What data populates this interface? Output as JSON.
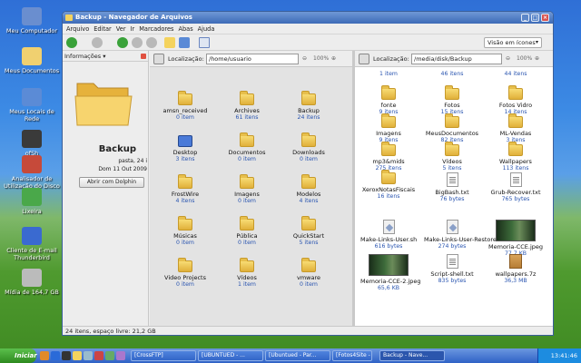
{
  "desktop": {
    "icons": [
      {
        "name": "computer-icon",
        "label": "Meu Computador"
      },
      {
        "name": "documents-icon",
        "label": "Meus Documentos"
      },
      {
        "name": "network-icon",
        "label": "Meus Locais de Rede"
      },
      {
        "name": "ssh-icon",
        "label": "ofSh"
      },
      {
        "name": "disk-analyzer-icon",
        "label": "Analisador de Utilização do Disco"
      },
      {
        "name": "trash-icon",
        "label": "Lixeira"
      },
      {
        "name": "thunderbird-icon",
        "label": "Cliente de E-mail Thunderbird"
      },
      {
        "name": "drive-icon",
        "label": "Mídia de 164,7 GB"
      }
    ]
  },
  "window": {
    "title": "Backup - Navegador de Arquivos",
    "menu": [
      "Arquivo",
      "Editar",
      "Ver",
      "Ir",
      "Marcadores",
      "Abas",
      "Ajuda"
    ],
    "view_mode": "Visão em ícones",
    "sidebar": {
      "header": "Informações",
      "name": "Backup",
      "type": "pasta, 24 i",
      "date": "Dom 11 Out 2009",
      "button": "Abrir com Dolphin"
    },
    "pane1": {
      "location_label": "Localização:",
      "path": "/home/usuario",
      "zoom": "100%",
      "items": [
        {
          "kind": "folder",
          "name": "amsn_received",
          "meta": "0 item"
        },
        {
          "kind": "folder",
          "name": "Archives",
          "meta": "61 itens"
        },
        {
          "kind": "folder",
          "name": "Backup",
          "meta": "24 itens"
        },
        {
          "kind": "desktop",
          "name": "Desktop",
          "meta": "3 itens"
        },
        {
          "kind": "folder",
          "name": "Documentos",
          "meta": "0 item"
        },
        {
          "kind": "folder",
          "name": "Downloads",
          "meta": "0 item"
        },
        {
          "kind": "folder",
          "name": "FrostWire",
          "meta": "4 itens"
        },
        {
          "kind": "folder",
          "name": "Imagens",
          "meta": "0 item"
        },
        {
          "kind": "folder",
          "name": "Modelos",
          "meta": "4 itens"
        },
        {
          "kind": "folder",
          "name": "Músicas",
          "meta": "0 item"
        },
        {
          "kind": "folder",
          "name": "Pública",
          "meta": "0 item"
        },
        {
          "kind": "folder",
          "name": "QuickStart",
          "meta": "5 itens"
        },
        {
          "kind": "folder",
          "name": "Video Projects",
          "meta": "0 item"
        },
        {
          "kind": "folder",
          "name": "Vídeos",
          "meta": "1 item"
        },
        {
          "kind": "folder",
          "name": "vmware",
          "meta": "0 item"
        }
      ]
    },
    "pane2": {
      "location_label": "Localização:",
      "path": "/media/disk/Backup",
      "zoom": "100%",
      "items": [
        {
          "kind": "folder",
          "name": "",
          "meta": "1 item"
        },
        {
          "kind": "folder",
          "name": "",
          "meta": "46 itens"
        },
        {
          "kind": "folder",
          "name": "",
          "meta": "44 itens"
        },
        {
          "kind": "folder",
          "name": "fonte",
          "meta": "9 itens"
        },
        {
          "kind": "folder",
          "name": "Fotos",
          "meta": "15 itens"
        },
        {
          "kind": "folder",
          "name": "Fotos Vidro",
          "meta": "14 itens"
        },
        {
          "kind": "folder",
          "name": "Imagens",
          "meta": "9 itens"
        },
        {
          "kind": "folder",
          "name": "MeusDocumentos",
          "meta": "82 itens"
        },
        {
          "kind": "folder",
          "name": "ML-Vendas",
          "meta": "3 itens"
        },
        {
          "kind": "folder",
          "name": "mp3&mids",
          "meta": "275 itens"
        },
        {
          "kind": "folder",
          "name": "Vídeos",
          "meta": "5 itens"
        },
        {
          "kind": "folder",
          "name": "Wallpapers",
          "meta": "113 itens"
        },
        {
          "kind": "folder",
          "name": "XeroxNotasFiscais",
          "meta": "16 itens"
        },
        {
          "kind": "text",
          "name": "BigBash.txt",
          "meta": "76 bytes"
        },
        {
          "kind": "text",
          "name": "Grub-Recover.txt",
          "meta": "765 bytes"
        },
        {
          "kind": "script",
          "name": "Make-Links-User.sh",
          "meta": "616 bytes"
        },
        {
          "kind": "script",
          "name": "Make-Links-User-Restore.sh",
          "meta": "274 bytes"
        },
        {
          "kind": "image",
          "name": "Memoria-CCE.jpeg",
          "meta": "77,7 KB"
        },
        {
          "kind": "image",
          "name": "Memoria-CCE-2.jpeg",
          "meta": "65,6 KB"
        },
        {
          "kind": "text",
          "name": "Script-shell.txt",
          "meta": "835 bytes"
        },
        {
          "kind": "archive",
          "name": "wallpapers.7z",
          "meta": "36,3 MB"
        }
      ]
    },
    "status": "24 itens, espaço livre: 21,2 GB"
  },
  "taskbar": {
    "start": "Iniciar",
    "tasks": [
      "[CrossFTP]",
      "[UBUNTUED - ...",
      "[Ubuntued - Par...",
      "[Fotos4Site - N...",
      "Backup - Nave..."
    ],
    "clock": "13:41:46"
  }
}
